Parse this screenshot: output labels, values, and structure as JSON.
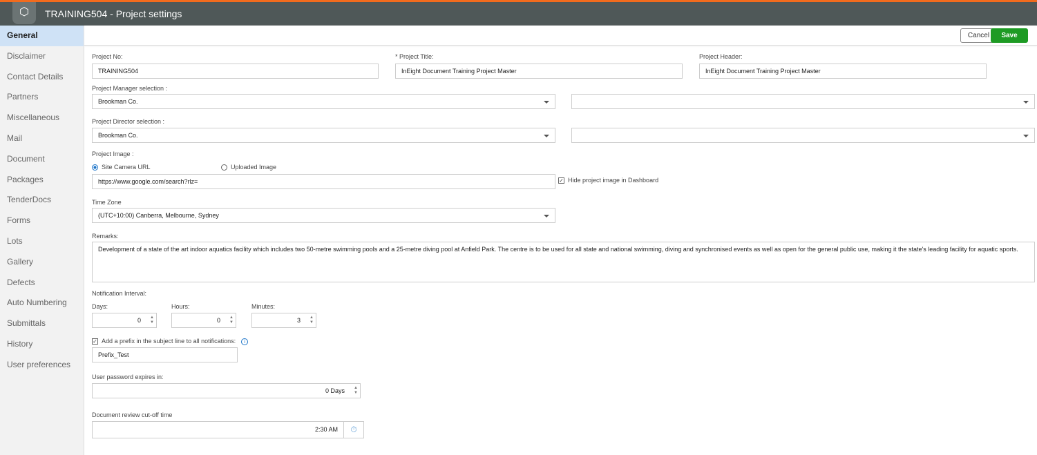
{
  "header": {
    "title": "TRAINING504 - Project settings"
  },
  "sidebar": {
    "items": [
      "General",
      "Disclaimer",
      "Contact Details",
      "Partners",
      "Miscellaneous",
      "Mail",
      "Document",
      "Packages",
      "TenderDocs",
      "Forms",
      "Lots",
      "Gallery",
      "Defects",
      "Auto Numbering",
      "Submittals",
      "History",
      "User preferences"
    ]
  },
  "toolbar": {
    "cancel": "Cancel",
    "save": "Save"
  },
  "form": {
    "project_no_label": "Project No:",
    "project_no": "TRAINING504",
    "project_title_label": "* Project Title:",
    "project_title": "InEight Document Training Project Master",
    "project_header_label": "Project Header:",
    "project_header": "InEight Document Training Project Master",
    "pm_label": "Project Manager selection :",
    "pm_value": "Brookman Co.",
    "pm_value2": "",
    "pd_label": "Project Director selection :",
    "pd_value": "Brookman Co.",
    "pd_value2": "",
    "image_label": "Project Image :",
    "site_camera": "Site Camera URL",
    "uploaded_image": "Uploaded Image",
    "url": "https://www.google.com/search?rlz=",
    "hide_image": "Hide project image in Dashboard",
    "tz_label": "Time Zone",
    "tz_value": "(UTC+10:00) Canberra, Melbourne, Sydney",
    "remarks_label": "Remarks:",
    "remarks": "Development of a state of the art indoor aquatics facility which includes two 50-metre swimming pools and a 25-metre diving pool at Anfield Park. The centre is to be used for all state and national swimming, diving and synchronised events as well as open for the general public use, making it the state's leading facility for aquatic sports.",
    "notif_label": "Notification Interval:",
    "days_label": "Days:",
    "days": "0",
    "hours_label": "Hours:",
    "hours": "0",
    "minutes_label": "Minutes:",
    "minutes": "3",
    "prefix_label": "Add a prefix in the subject line to all notifications:",
    "prefix": "Prefix_Test",
    "pwd_label": "User password expires in:",
    "pwd": "0 Days",
    "cutoff_label": "Document review cut-off time",
    "cutoff": "2:30 AM"
  }
}
